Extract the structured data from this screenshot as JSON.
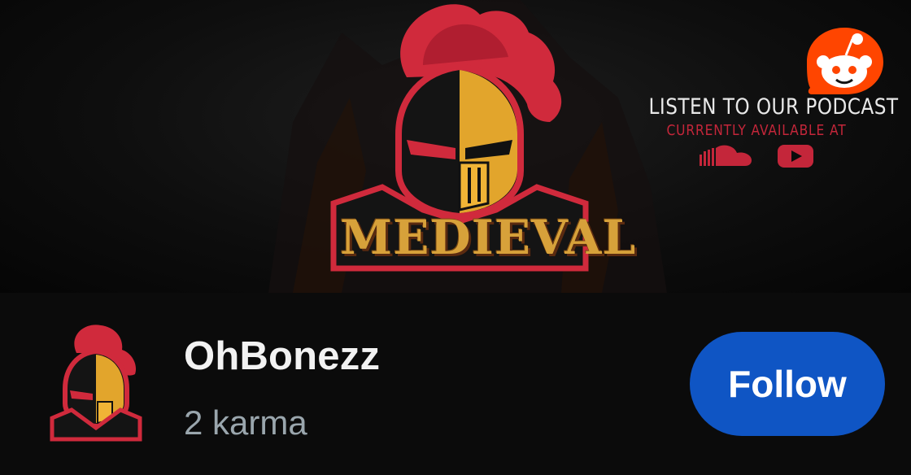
{
  "banner": {
    "wordmark": "MEDIEVAL",
    "podcast_title": "LISTEN TO OUR PODCAST",
    "podcast_sub": "CURRENTLY AVAILABLE AT",
    "icons": [
      "soundcloud-icon",
      "youtube-icon"
    ]
  },
  "app_icon": "reddit-icon",
  "profile": {
    "avatar_icon": "knight-avatar-icon",
    "username": "OhBonezz",
    "karma": "2 karma",
    "follow_label": "Follow"
  },
  "colors": {
    "background": "#0b0b0b",
    "follow_button": "#0f55c4",
    "reddit_orange": "#ff4500",
    "accent_red": "#c4263a",
    "gold": "#d7a13a"
  }
}
